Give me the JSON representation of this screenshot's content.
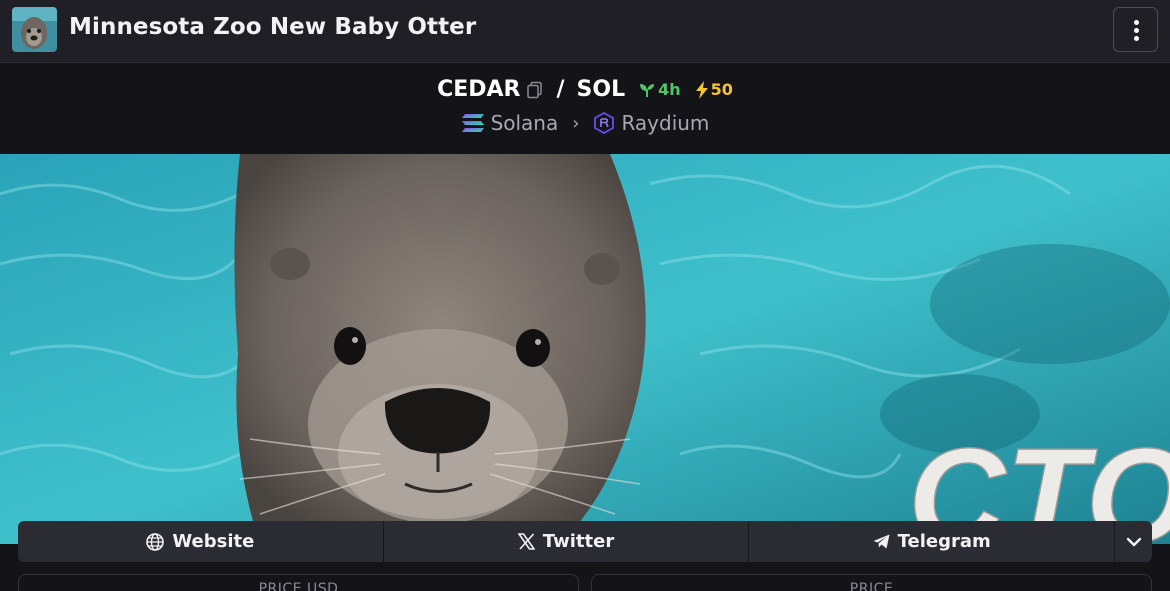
{
  "header": {
    "title": "Minnesota Zoo New Baby Otter",
    "avatar_icon": "otter-avatar-icon",
    "menu_icon": "kebab-menu-icon"
  },
  "pair": {
    "base": "CEDAR",
    "separator": "/",
    "quote": "SOL",
    "age": "4h",
    "boost": "50",
    "age_color": "#52c46a",
    "boost_color": "#f7c331"
  },
  "chain": {
    "network": "Solana",
    "dex": "Raydium"
  },
  "banner": {
    "overlay_text": "CTO"
  },
  "links": [
    {
      "label": "Website",
      "icon": "globe-icon"
    },
    {
      "label": "Twitter",
      "icon": "x-logo-icon"
    },
    {
      "label": "Telegram",
      "icon": "telegram-icon"
    }
  ],
  "stats": {
    "price_usd_label": "PRICE USD",
    "price_label": "PRICE"
  }
}
